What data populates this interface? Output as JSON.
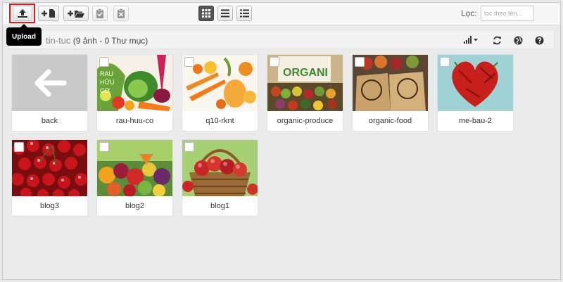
{
  "toolbar": {
    "upload_tooltip": "Upload",
    "filter_label": "Lọc:",
    "filter_placeholder": "lọc theo tên..."
  },
  "breadcrumb": {
    "folder": "tin-tuc",
    "summary": "(9 ảnh - 0 Thư mục)"
  },
  "items": [
    {
      "label": "back"
    },
    {
      "label": "rau-huu-co"
    },
    {
      "label": "q10-rknt"
    },
    {
      "label": "organic-produce"
    },
    {
      "label": "organic-food"
    },
    {
      "label": "me-bau-2"
    },
    {
      "label": "blog3"
    },
    {
      "label": "blog2"
    },
    {
      "label": "blog1"
    }
  ],
  "colors": {
    "highlight": "#e0191f",
    "tooltip_bg": "#000000"
  }
}
